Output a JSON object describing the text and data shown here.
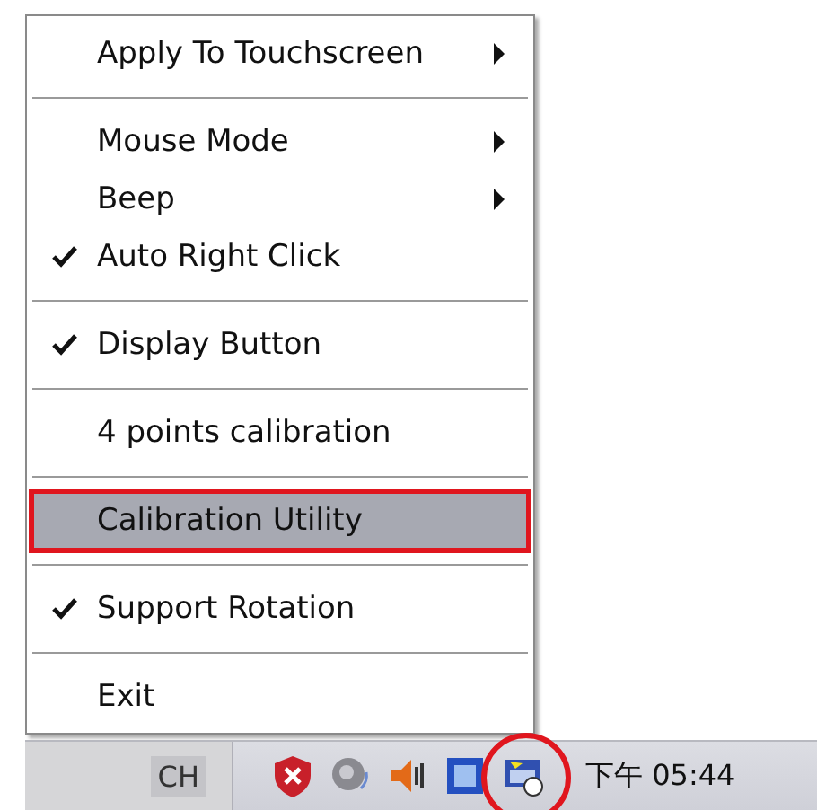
{
  "menu": {
    "items": [
      {
        "kind": "item",
        "label": "Apply To Touchscreen",
        "checked": false,
        "submenu": true,
        "selected": false,
        "outlined": false
      },
      {
        "kind": "separator"
      },
      {
        "kind": "item",
        "label": "Mouse Mode",
        "checked": false,
        "submenu": true,
        "selected": false,
        "outlined": false
      },
      {
        "kind": "item",
        "label": "Beep",
        "checked": false,
        "submenu": true,
        "selected": false,
        "outlined": false
      },
      {
        "kind": "item",
        "label": "Auto Right Click",
        "checked": true,
        "submenu": false,
        "selected": false,
        "outlined": false
      },
      {
        "kind": "separator"
      },
      {
        "kind": "item",
        "label": "Display Button",
        "checked": true,
        "submenu": false,
        "selected": false,
        "outlined": false
      },
      {
        "kind": "separator"
      },
      {
        "kind": "item",
        "label": "4 points calibration",
        "checked": false,
        "submenu": false,
        "selected": false,
        "outlined": false
      },
      {
        "kind": "separator"
      },
      {
        "kind": "item",
        "label": "Calibration Utility",
        "checked": false,
        "submenu": false,
        "selected": true,
        "outlined": true
      },
      {
        "kind": "separator"
      },
      {
        "kind": "item",
        "label": "Support Rotation",
        "checked": true,
        "submenu": false,
        "selected": false,
        "outlined": false
      },
      {
        "kind": "separator"
      },
      {
        "kind": "item",
        "label": "Exit",
        "checked": false,
        "submenu": false,
        "selected": false,
        "outlined": false
      }
    ]
  },
  "taskbar": {
    "language": "CH",
    "clock": "下午 05:44",
    "circled_icon": true
  }
}
